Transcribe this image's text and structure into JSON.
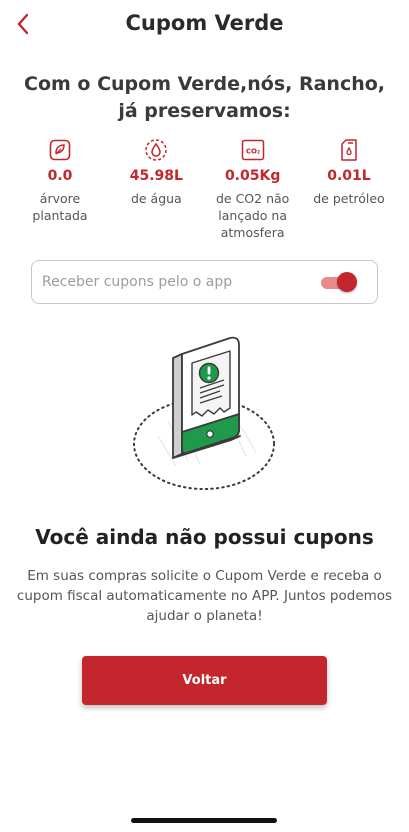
{
  "header": {
    "back_icon": "chevron-left-icon",
    "title": "Cupom Verde"
  },
  "headline": "Com o Cupom Verde,nós, Rancho, já preservamos:",
  "stats": [
    {
      "icon": "leaf-icon",
      "value": "0.0",
      "label": "árvore plantada"
    },
    {
      "icon": "water-drop-icon",
      "value": "45.98L",
      "label": "de água"
    },
    {
      "icon": "co2-icon",
      "value": "0.05Kg",
      "label": "de CO2 não lançado na atmosfera"
    },
    {
      "icon": "fuel-can-icon",
      "value": "0.01L",
      "label": "de petróleo"
    }
  ],
  "toggle": {
    "label": "Receber cupons pelo o app",
    "on": true
  },
  "illustration": {
    "icon": "phone-receipt-icon",
    "badge": "!"
  },
  "empty_state": {
    "title": "Você ainda não possui cupons",
    "description": "Em suas compras solicite o Cupom Verde e receba o cupom fiscal automaticamente no APP. Juntos podemos ajudar o planeta!"
  },
  "button": {
    "label": "Voltar"
  },
  "colors": {
    "accent": "#c4262e",
    "accent_light": "#e88a8a",
    "green": "#1f9a4a"
  }
}
